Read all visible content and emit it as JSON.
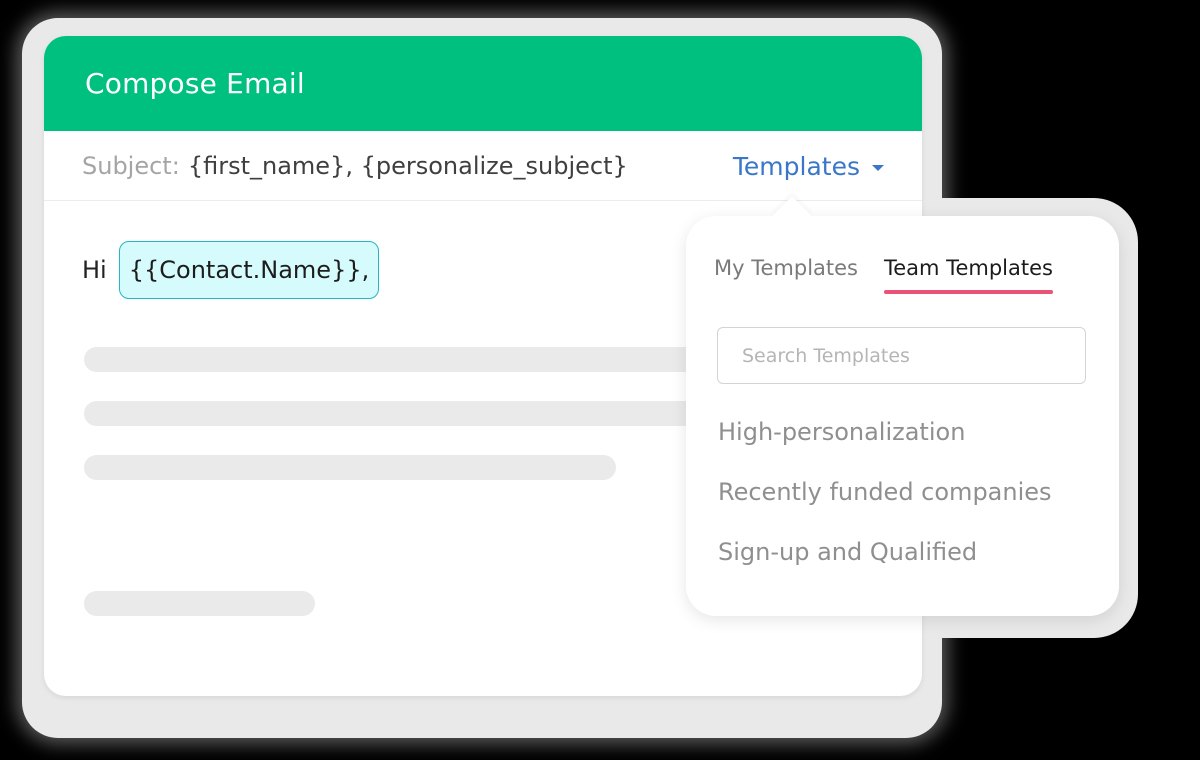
{
  "window": {
    "title": "Compose Email"
  },
  "subject": {
    "label": "Subject:",
    "value": "{first_name}, {personalize_subject}"
  },
  "templates_button": {
    "label": "Templates",
    "icon": "caret-down-icon"
  },
  "body": {
    "greeting": "Hi",
    "token": "{{Contact.Name}},"
  },
  "templates_popover": {
    "tabs": [
      {
        "label": "My Templates",
        "active": false
      },
      {
        "label": "Team Templates",
        "active": true
      }
    ],
    "search": {
      "placeholder": "Search Templates",
      "value": ""
    },
    "items": [
      {
        "label": "High-personalization"
      },
      {
        "label": "Recently funded companies"
      },
      {
        "label": "Sign-up and Qualified"
      }
    ]
  },
  "colors": {
    "header": "#00c07f",
    "link": "#3a77c9",
    "tab_underline": "#ea5276",
    "token_bg": "#d5fbfc",
    "token_border": "#23b7c2"
  }
}
